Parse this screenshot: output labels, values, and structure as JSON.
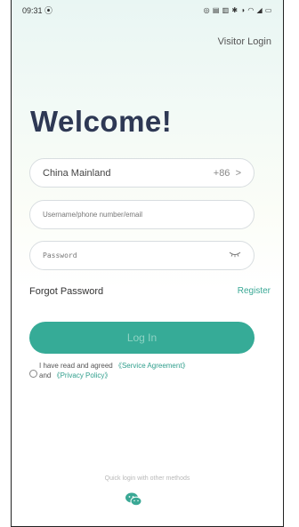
{
  "status_bar": {
    "time": "09:31",
    "left_icon": "⦿",
    "right_icons": "◎ ▤ ▥ ✱ ◑ ◠ ◢ ▭"
  },
  "header": {
    "visitor_login": "Visitor Login"
  },
  "welcome": "Welcome!",
  "region": {
    "name": "China Mainland",
    "code": "+86",
    "chevron": ">"
  },
  "username": {
    "placeholder": "Username/phone number/email"
  },
  "password": {
    "placeholder": "Password",
    "toggle_icon": "eye-closed-icon"
  },
  "links": {
    "forgot": "Forgot Password",
    "register": "Register"
  },
  "login_button": "Log In",
  "agreement": {
    "text": "I have read and agreed",
    "service": "《Service Agreement》",
    "and": "and",
    "privacy": "《Privacy Policy》"
  },
  "quick_login": {
    "label": "Quick login with other methods",
    "icon": "wechat-icon"
  },
  "colors": {
    "accent": "#36ab97",
    "title": "#2e3854",
    "link": "#2f9e8c"
  }
}
